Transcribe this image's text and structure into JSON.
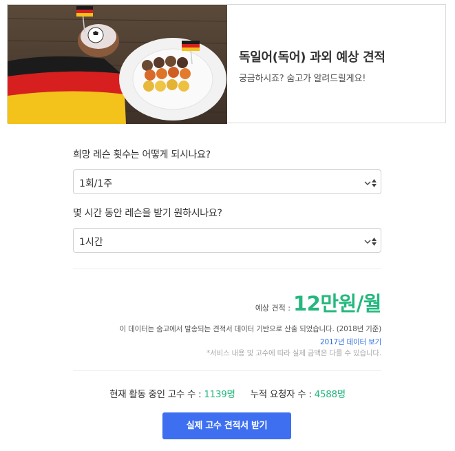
{
  "banner": {
    "title": "독일어(독어) 과외 예상 견적",
    "subtitle": "궁금하시죠? 숨고가 알려드릴게요!"
  },
  "questions": [
    {
      "label": "희망 레슨 횟수는 어떻게 되시나요?",
      "selected": "1회/1주"
    },
    {
      "label": "몇 시간 동안 레슨을 받기 원하시나요?",
      "selected": "1시간"
    }
  ],
  "estimate": {
    "label": "예상 견적 :",
    "value": "12만원/월"
  },
  "notes": {
    "basis": "이 데이터는 숨고에서 발송되는 견적서 데이터 기반으로 산출 되었습니다. (2018년 기준)",
    "link_2017": "2017년 데이터 보기",
    "disclaimer": "*서비스 내용 및 고수에 따라 실제 금액은 다를 수 있습니다."
  },
  "stats": {
    "active_label": "현재 활동 중인 고수 수 :",
    "active_value": "1139명",
    "requesters_label": "누적 요청자 수 :",
    "requesters_value": "4588명"
  },
  "cta": {
    "label": "실제 고수 견적서 받기"
  },
  "colors": {
    "accent_green": "#25b87e",
    "cta_blue": "#3d6ff0",
    "link_blue": "#2f6fe0"
  }
}
